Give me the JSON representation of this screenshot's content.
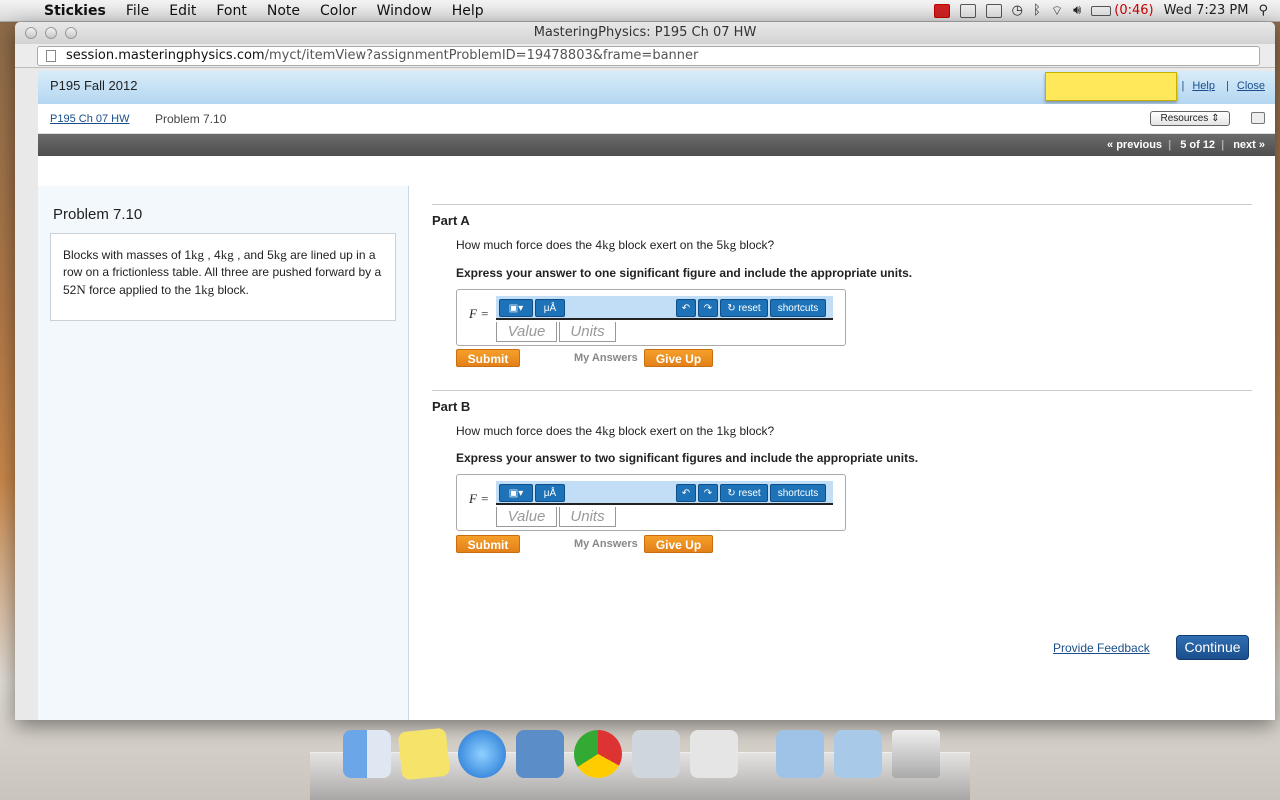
{
  "menubar": {
    "app": "Stickies",
    "items": [
      "File",
      "Edit",
      "Font",
      "Note",
      "Color",
      "Window",
      "Help"
    ],
    "battery": "(0:46)",
    "clock": "Wed 7:23 PM"
  },
  "window": {
    "title": "MasteringPhysics: P195 Ch 07 HW",
    "url_host": "session.masteringphysics.com",
    "url_path": "/myct/itemView?assignmentProblemID=19478803&frame=banner"
  },
  "header": {
    "course": "P195 Fall 2012",
    "help": "Help",
    "close": "Close",
    "breadcrumb_link": "P195 Ch 07 HW",
    "breadcrumb_current": "Problem 7.10",
    "resources": "Resources",
    "nav_previous": "« previous",
    "nav_position": "5 of 12",
    "nav_next": "next »"
  },
  "problem": {
    "title": "Problem 7.10",
    "text_1": "Blocks with masses of 1",
    "u1": "kg",
    "text_2": " , 4",
    "u2": "kg",
    "text_3": " , and 5",
    "u3": "kg",
    "text_4": " are lined up in a row on a frictionless table. All three are pushed forward by a 52",
    "u4": "N",
    "text_5": " force applied to the 1",
    "u5": "kg",
    "text_6": " block."
  },
  "partA": {
    "title": "Part A",
    "q1": "How much force does the 4",
    "qu1": "kg",
    "q2": " block exert on the 5",
    "qu2": "kg",
    "q3": " block?",
    "instruction": "Express your answer to one significant figure and include the appropriate units.",
    "label": "F =",
    "value_placeholder": "Value",
    "units_placeholder": "Units",
    "submit": "Submit",
    "my_answers": "My Answers",
    "give_up": "Give Up"
  },
  "partB": {
    "title": "Part B",
    "q1": "How much force does the 4",
    "qu1": "kg",
    "q2": " block exert on the 1",
    "qu2": "kg",
    "q3": " block?",
    "instruction": "Express your answer to two significant figures and include the appropriate units.",
    "label": "F =",
    "value_placeholder": "Value",
    "units_placeholder": "Units",
    "submit": "Submit",
    "my_answers": "My Answers",
    "give_up": "Give Up"
  },
  "toolbar": {
    "units_btn": "μÅ",
    "reset": "reset",
    "shortcuts": "shortcuts"
  },
  "footer": {
    "feedback": "Provide Feedback",
    "continue": "Continue"
  },
  "colors": {
    "accent_orange": "#e3801a",
    "link_blue": "#1a4f8c",
    "toolbar_blue": "#1e73b8"
  }
}
